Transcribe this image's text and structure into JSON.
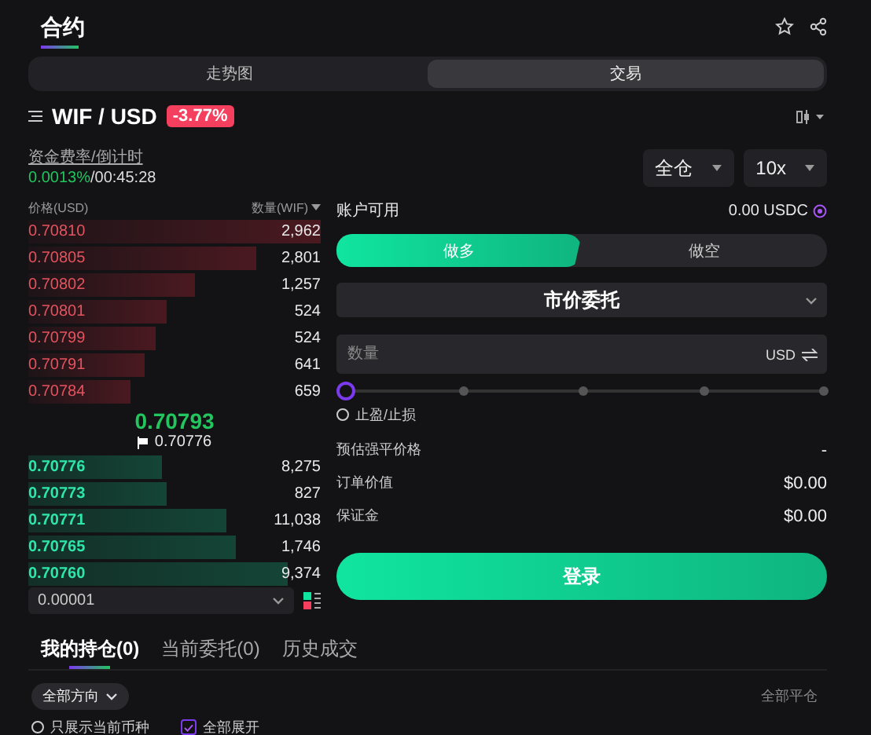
{
  "header": {
    "title": "合约"
  },
  "view_tabs": [
    {
      "label": "走势图",
      "selected": false
    },
    {
      "label": "交易",
      "selected": true
    }
  ],
  "pair": {
    "symbol": "WIF / USD",
    "change": "-3.77%"
  },
  "funding": {
    "label": "资金费率/倒计时",
    "rate": "0.0013%",
    "countdown": "/00:45:28"
  },
  "margin_mode": "全仓",
  "leverage": "10x",
  "order_book": {
    "price_header": "价格(USD)",
    "qty_header": "数量(WIF)",
    "asks": [
      {
        "price": "0.70810",
        "qty": "2,962"
      },
      {
        "price": "0.70805",
        "qty": "2,801"
      },
      {
        "price": "0.70802",
        "qty": "1,257"
      },
      {
        "price": "0.70801",
        "qty": "524"
      },
      {
        "price": "0.70799",
        "qty": "524"
      },
      {
        "price": "0.70791",
        "qty": "641"
      },
      {
        "price": "0.70784",
        "qty": "659"
      }
    ],
    "last_price": "0.70793",
    "mark_price": "0.70776",
    "bids": [
      {
        "price": "0.70776",
        "qty": "8,275"
      },
      {
        "price": "0.70773",
        "qty": "827"
      },
      {
        "price": "0.70771",
        "qty": "11,038"
      },
      {
        "price": "0.70765",
        "qty": "1,746"
      },
      {
        "price": "0.70760",
        "qty": "9,374"
      }
    ],
    "tick_size": "0.00001"
  },
  "order_form": {
    "available_label": "账户可用",
    "available_value": "0.00 USDC",
    "sides": [
      {
        "label": "做多",
        "selected": true
      },
      {
        "label": "做空",
        "selected": false
      }
    ],
    "order_type": "市价委托",
    "quantity": {
      "placeholder": "数量",
      "unit": "USD"
    },
    "slider": {
      "level": 0
    },
    "tpsl": {
      "label": "止盈/止损",
      "checked": false
    },
    "details": [
      {
        "label": "预估强平价格",
        "value": "-"
      },
      {
        "label": "订单价值",
        "value": "$0.00"
      },
      {
        "label": "保证金",
        "value": "$0.00"
      }
    ],
    "submit": "登录"
  },
  "positions": {
    "tabs": [
      {
        "label": "我的持仓(0)",
        "selected": true
      },
      {
        "label": "当前委托(0)",
        "selected": false
      },
      {
        "label": "历史成交",
        "selected": false
      }
    ],
    "direction_filter": "全部方向",
    "close_all": "全部平仓",
    "options": [
      {
        "label": "只展示当前币种",
        "checked": false
      },
      {
        "label": "全部展开",
        "checked": true
      }
    ]
  }
}
